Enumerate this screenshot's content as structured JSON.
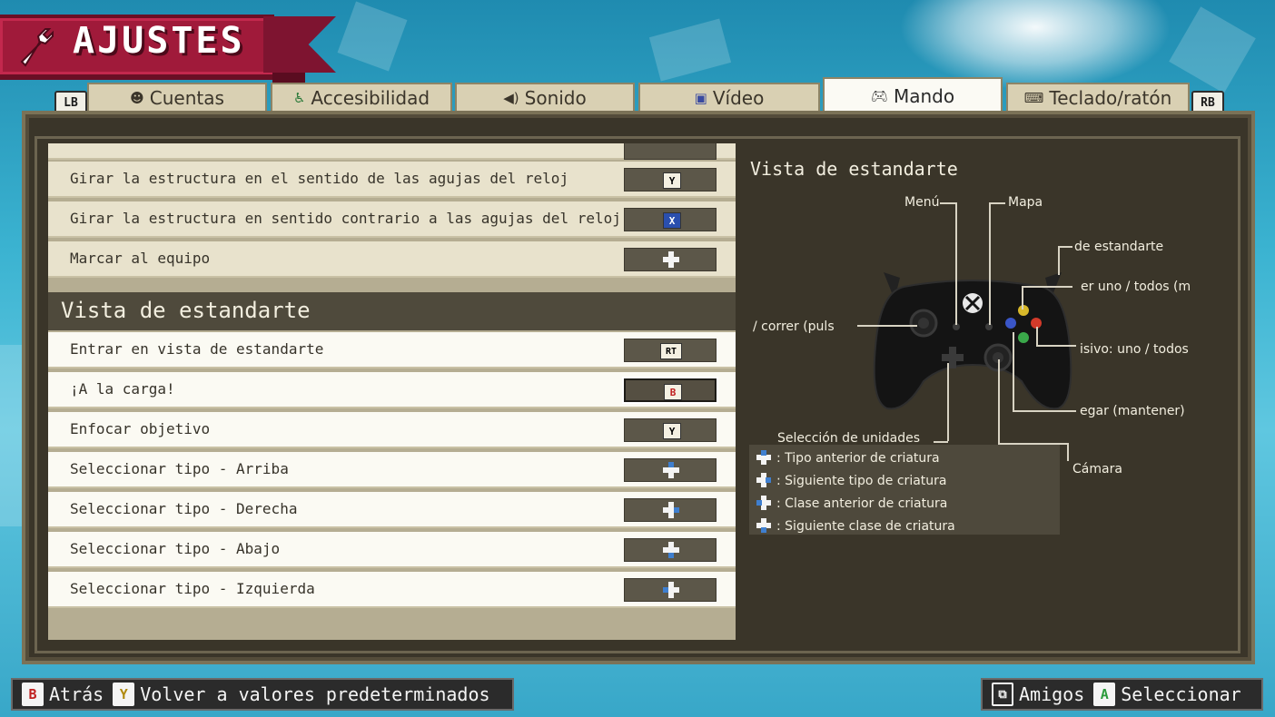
{
  "header": {
    "title": "AJUSTES"
  },
  "tabs": [
    {
      "label": "Cuentas",
      "icon": "account-icon",
      "active": false
    },
    {
      "label": "Accesibilidad",
      "icon": "accessibility-icon",
      "active": false
    },
    {
      "label": "Sonido",
      "icon": "speaker-icon",
      "active": false
    },
    {
      "label": "Vídeo",
      "icon": "monitor-icon",
      "active": false
    },
    {
      "label": "Mando",
      "icon": "gamepad-icon",
      "active": true
    },
    {
      "label": "Teclado/ratón",
      "icon": "keyboard-icon",
      "active": false
    }
  ],
  "shoulders": {
    "left": "LB",
    "right": "RB"
  },
  "bindings_top": [
    {
      "label": "Girar la estructura en el sentido de las agujas del reloj",
      "key": "Y"
    },
    {
      "label": "Girar la estructura en sentido contrario a las agujas del reloj",
      "key": "X"
    },
    {
      "label": "Marcar al equipo",
      "key": "dpad"
    }
  ],
  "section": {
    "title": "Vista de estandarte"
  },
  "bindings": [
    {
      "label": "Entrar en vista de estandarte",
      "key": "RT"
    },
    {
      "label": "¡A la carga!",
      "key": "B"
    },
    {
      "label": "Enfocar objetivo",
      "key": "Y"
    },
    {
      "label": "Seleccionar tipo - Arriba",
      "key": "dpad-up"
    },
    {
      "label": "Seleccionar tipo - Derecha",
      "key": "dpad-right"
    },
    {
      "label": "Seleccionar tipo - Abajo",
      "key": "dpad-down"
    },
    {
      "label": "Seleccionar tipo - Izquierda",
      "key": "dpad-left"
    }
  ],
  "right_panel": {
    "title": "Vista de estandarte",
    "callouts": {
      "menu": "Menú",
      "map": "Mapa",
      "banner": "de estandarte",
      "select_one": "er uno / todos (m",
      "run": "/ correr (puls",
      "passive": "isivo: uno / todos",
      "deploy": "egar (mantener)",
      "unit_select": "Selección de unidades",
      "camera": "Cámara"
    },
    "legend": [
      {
        "dir": "up",
        "text": ": Tipo anterior de criatura"
      },
      {
        "dir": "right",
        "text": ": Siguiente tipo de criatura"
      },
      {
        "dir": "left",
        "text": ": Clase anterior de criatura"
      },
      {
        "dir": "down",
        "text": ": Siguiente clase de criatura"
      }
    ]
  },
  "footer": {
    "back": {
      "key": "B",
      "label": "Atrás"
    },
    "reset": {
      "key": "Y",
      "label": "Volver a valores predeterminados"
    },
    "friends": {
      "label": "Amigos"
    },
    "select": {
      "key": "A",
      "label": "Seleccionar"
    }
  },
  "colors": {
    "banner": "#a01a3a",
    "panel": "#3a3529",
    "row": "#e8e2cc",
    "dpad_highlight": "#3f7fcf"
  }
}
